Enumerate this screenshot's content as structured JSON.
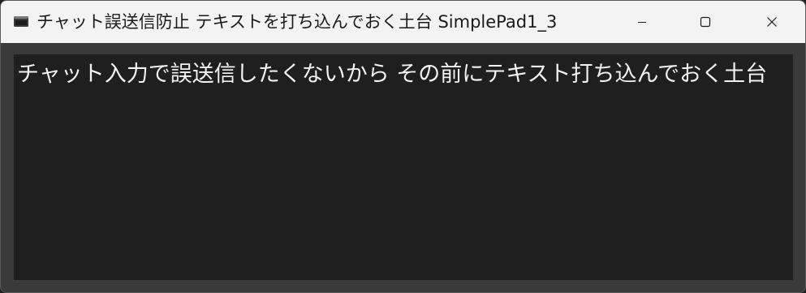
{
  "window": {
    "title": "チャット誤送信防止 テキストを打ち込んでおく土台 SimplePad1_3",
    "app_icon": "terminal-icon",
    "controls": {
      "minimize_icon": "minimize-icon",
      "maximize_icon": "maximize-icon",
      "close_icon": "close-icon"
    }
  },
  "editor": {
    "text": "チャット入力で誤送信したくないから その前にテキスト打ち込んでおく土台"
  },
  "colors": {
    "titlebar_bg": "#f3f3f3",
    "frame_bg": "#3a3a3a",
    "editor_bg": "#1f1f1f",
    "editor_text": "#f2f2f2"
  }
}
